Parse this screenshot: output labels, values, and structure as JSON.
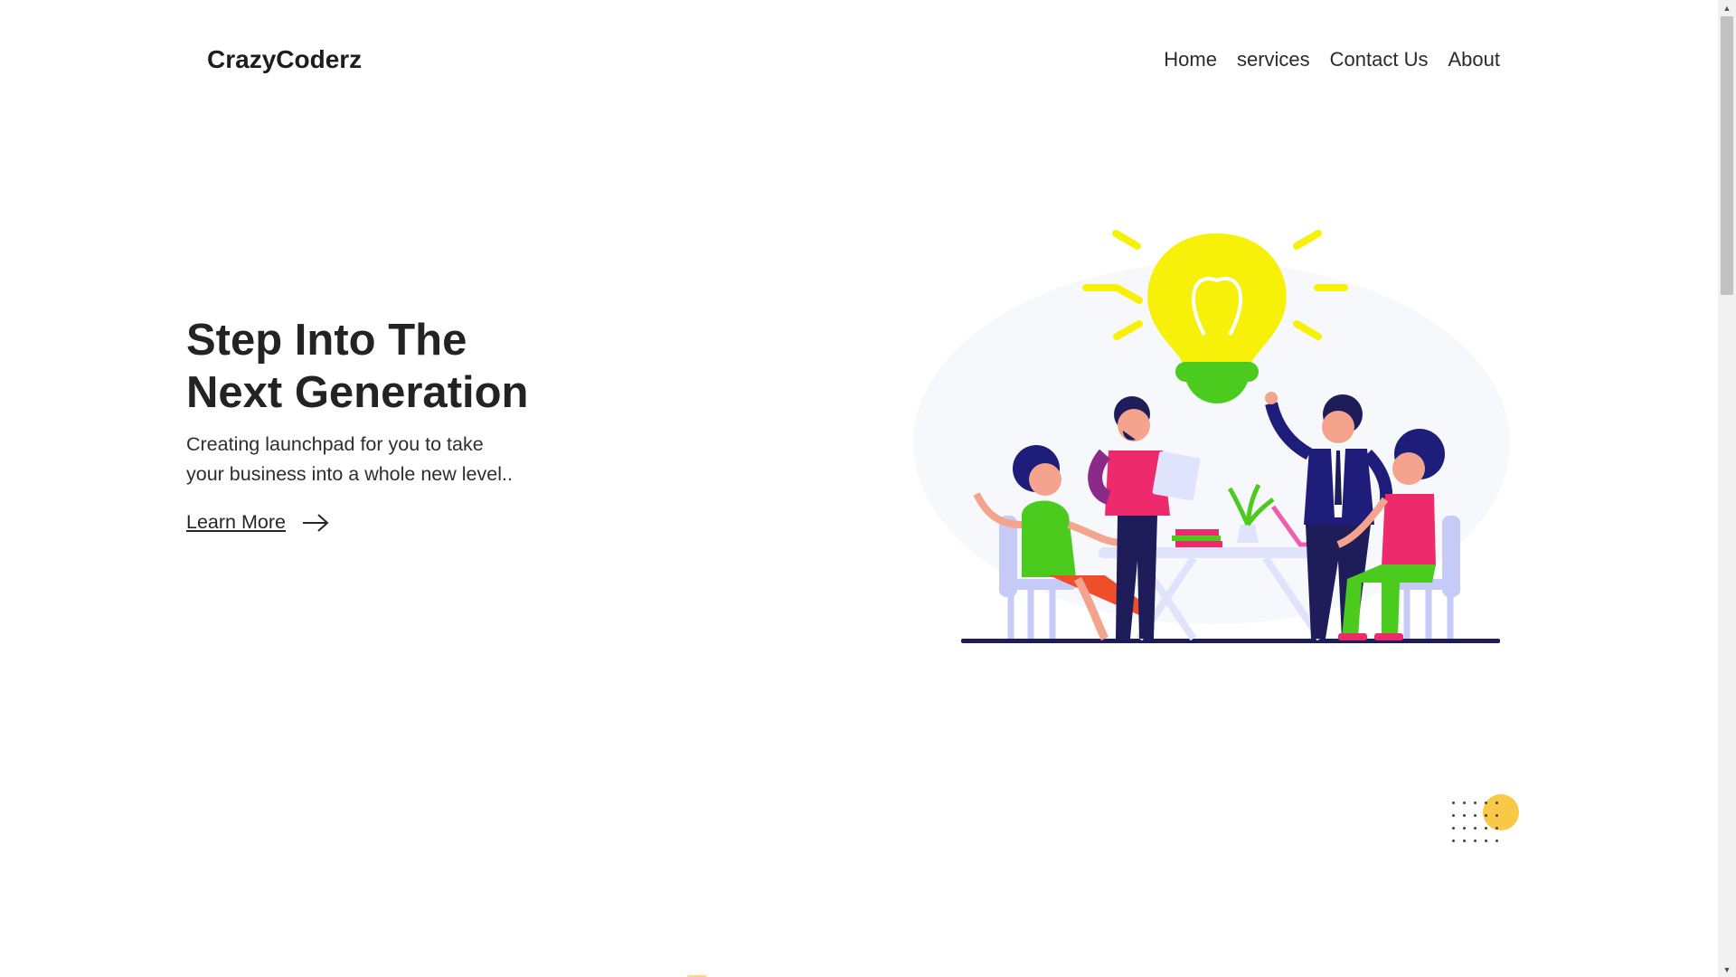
{
  "header": {
    "brand": "CrazyCoderz",
    "nav": [
      {
        "label": "Home"
      },
      {
        "label": "services"
      },
      {
        "label": "Contact Us"
      },
      {
        "label": "About"
      }
    ]
  },
  "hero": {
    "title_line1": "Step Into The",
    "title_line2": "Next Generation",
    "subtitle_line1": "Creating launchpad for you to take",
    "subtitle_line2": "your business into a whole new level..",
    "cta_label": "Learn More",
    "illustration_icon": "team-idea-lightbulb-illustration"
  },
  "colors": {
    "accent_yellow": "#f9c846",
    "bulb_yellow": "#f7f10a",
    "bulb_green": "#4ccb1f",
    "text_dark": "#232323"
  },
  "scrollbar": {
    "position": 0
  }
}
